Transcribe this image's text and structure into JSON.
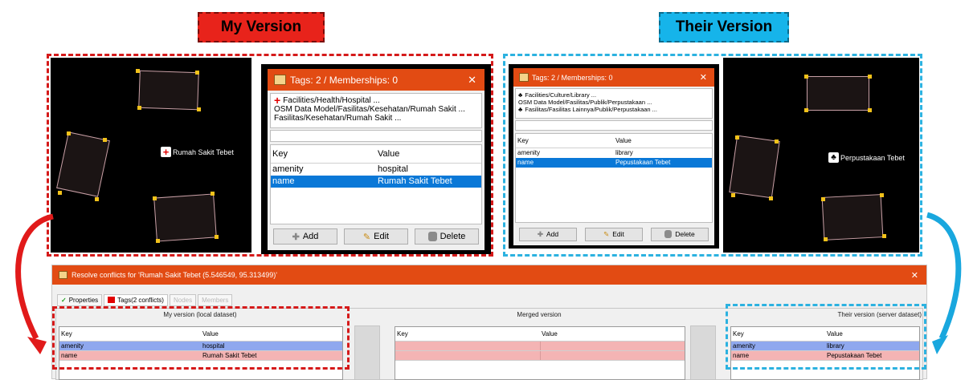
{
  "labels": {
    "my_version": "My Version",
    "their_version": "Their Version"
  },
  "my_map": {
    "poi_label": "Rumah Sakit Tebet",
    "poi_icon": "hospital-cross-icon"
  },
  "their_map": {
    "poi_label": "Perpustakaan Tebet",
    "poi_icon": "library-icon"
  },
  "my_dialog": {
    "title": "Tags: 2 / Memberships: 0",
    "close": "✕",
    "presets": [
      "Facilities/Health/Hospital ...",
      "OSM Data Model/Fasilitas/Kesehatan/Rumah Sakit ...",
      "Fasilitas/Kesehatan/Rumah Sakit ..."
    ],
    "headers": {
      "key": "Key",
      "value": "Value"
    },
    "rows": [
      {
        "key": "amenity",
        "value": "hospital",
        "selected": false
      },
      {
        "key": "name",
        "value": "Rumah Sakit Tebet",
        "selected": true
      }
    ],
    "buttons": {
      "add": "Add",
      "edit": "Edit",
      "delete": "Delete"
    }
  },
  "their_dialog": {
    "title": "Tags: 2 / Memberships: 0",
    "close": "✕",
    "presets": [
      "Facilities/Culture/Library ...",
      "OSM Data Model/Fasilitas/Publik/Perpustakaan ...",
      "Fasilitas/Fasilitas Lainnya/Publik/Perpustakaan ..."
    ],
    "headers": {
      "key": "Key",
      "value": "Value"
    },
    "rows": [
      {
        "key": "amenity",
        "value": "library",
        "selected": false
      },
      {
        "key": "name",
        "value": "Pepustakaan Tebet",
        "selected": true
      }
    ],
    "buttons": {
      "add": "Add",
      "edit": "Edit",
      "delete": "Delete"
    }
  },
  "conflict": {
    "title": "Resolve conflicts for 'Rumah Sakit Tebet (5.546549, 95.313499)'",
    "close": "✕",
    "tabs": [
      {
        "label": "Properties",
        "enabled": true
      },
      {
        "label": "Tags(2 conflicts)",
        "enabled": true
      },
      {
        "label": "Nodes",
        "enabled": false
      },
      {
        "label": "Members",
        "enabled": false
      }
    ],
    "my_pane": {
      "title": "My version (local dataset)",
      "headers": {
        "key": "Key",
        "value": "Value"
      },
      "rows": [
        {
          "key": "amenity",
          "value": "hospital"
        },
        {
          "key": "name",
          "value": "Rumah Sakit Tebet"
        }
      ]
    },
    "merged_pane": {
      "title": "Merged version",
      "headers": {
        "key": "Key",
        "value": "Value"
      }
    },
    "their_pane": {
      "title": "Their version (server dataset)",
      "headers": {
        "key": "Key",
        "value": "Value"
      },
      "rows": [
        {
          "key": "amenity",
          "value": "library"
        },
        {
          "key": "name",
          "value": "Pepustakaan Tebet"
        }
      ]
    }
  },
  "colors": {
    "title_bar": "#e24b13",
    "selection": "#0a78d7",
    "red_dash": "#d51a1a",
    "blue_dash": "#2cb2e0"
  }
}
